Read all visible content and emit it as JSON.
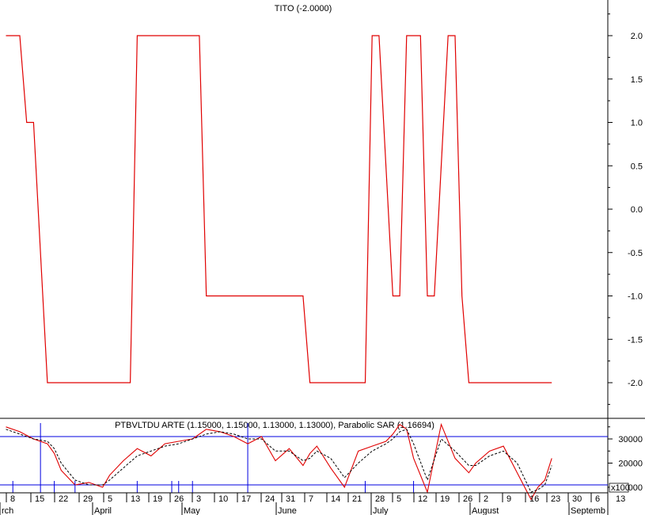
{
  "chart_data": [
    {
      "type": "line",
      "title": "TITO (-2.0000)",
      "xlabel": "",
      "ylabel": "",
      "ylim": [
        -2.4,
        2.4
      ],
      "y_ticks": [
        "2.0",
        "1.5",
        "1.0",
        "0.5",
        "0.0",
        "-0.5",
        "-1.0",
        "-1.5",
        "-2.0"
      ],
      "y_tick_values": [
        2.0,
        1.5,
        1.0,
        0.5,
        0.0,
        -0.5,
        -1.0,
        -1.5,
        -2.0
      ],
      "line_color": "#e00000",
      "series": [
        {
          "x": [
            0,
            2,
            3,
            4,
            6,
            18,
            19,
            20,
            27,
            28,
            29,
            35,
            36,
            37,
            43,
            44,
            45,
            52,
            53,
            54,
            56,
            57,
            58,
            60,
            61,
            62,
            64,
            65,
            66,
            67,
            79
          ],
          "values": [
            2,
            2,
            1,
            1,
            -2,
            -2,
            2,
            2,
            2,
            2,
            -1,
            -1,
            -1,
            -1,
            -1,
            -2,
            -2,
            -2,
            2,
            2,
            -1,
            -1,
            2,
            2,
            -1,
            -1,
            2,
            2,
            -1,
            -2,
            -2
          ]
        }
      ]
    },
    {
      "type": "line",
      "title": "PTBVLTDU ARTE (1.15000, 1.15000, 1.13000, 1.13000), Parabolic SAR (1.16694)",
      "xlabel": "",
      "ylabel": "",
      "ylim": [
        0,
        38000
      ],
      "y_ticks": [
        "30000",
        "20000",
        "10000"
      ],
      "y_tick_values": [
        30000,
        20000,
        10000
      ],
      "y_multiplier_label": "x100",
      "horizontal_lines": [
        31000,
        11000
      ],
      "x_tick_labels": [
        "8",
        "15",
        "22",
        "29",
        "5",
        "13",
        "19",
        "26",
        "3",
        "10",
        "17",
        "24",
        "31",
        "7",
        "14",
        "21",
        "28",
        "5",
        "12",
        "19",
        "26",
        "2",
        "9",
        "16",
        "23",
        "30",
        "6",
        "13"
      ],
      "month_labels": [
        "rch",
        "April",
        "May",
        "June",
        "July",
        "August",
        "Septemb"
      ],
      "series": [
        {
          "style": "solid",
          "color": "#e00000",
          "x": [
            0,
            2,
            4,
            6,
            7,
            8,
            10,
            12,
            14,
            15,
            17,
            19,
            21,
            23,
            25,
            27,
            29,
            31,
            33,
            35,
            37,
            39,
            41,
            43,
            44,
            45,
            47,
            49,
            51,
            53,
            55,
            56,
            57,
            58,
            59,
            61,
            63,
            65,
            67,
            68,
            70,
            72,
            74,
            76,
            77,
            78,
            79
          ],
          "values": [
            35000,
            33000,
            30000,
            28000,
            24000,
            17000,
            11000,
            12000,
            10000,
            15000,
            21000,
            26000,
            23000,
            28000,
            29000,
            30000,
            34000,
            33000,
            31000,
            28000,
            31000,
            21000,
            26000,
            19000,
            24000,
            27000,
            18000,
            10000,
            25000,
            27000,
            29000,
            32000,
            36000,
            34000,
            22000,
            8000,
            36000,
            22000,
            16000,
            20000,
            25000,
            27000,
            16000,
            5000,
            10000,
            13000,
            22000
          ]
        },
        {
          "style": "dashed",
          "color": "#000000",
          "x": [
            0,
            2,
            4,
            6,
            7,
            8,
            10,
            12,
            14,
            15,
            17,
            19,
            21,
            23,
            25,
            27,
            29,
            31,
            33,
            35,
            37,
            39,
            41,
            43,
            44,
            45,
            47,
            49,
            51,
            53,
            55,
            56,
            57,
            58,
            59,
            61,
            63,
            65,
            67,
            68,
            70,
            72,
            74,
            76,
            77,
            78,
            79
          ],
          "values": [
            34000,
            32000,
            30000,
            29000,
            26000,
            20000,
            13000,
            11000,
            11000,
            13000,
            18000,
            23000,
            25000,
            27000,
            28000,
            30000,
            32000,
            33000,
            32000,
            30000,
            30000,
            25000,
            25000,
            21000,
            22000,
            25000,
            22000,
            14000,
            20000,
            25000,
            28000,
            30000,
            33000,
            34000,
            28000,
            13000,
            30000,
            25000,
            19000,
            19000,
            23000,
            25000,
            20000,
            8000,
            9000,
            11000,
            19000
          ]
        }
      ]
    }
  ]
}
